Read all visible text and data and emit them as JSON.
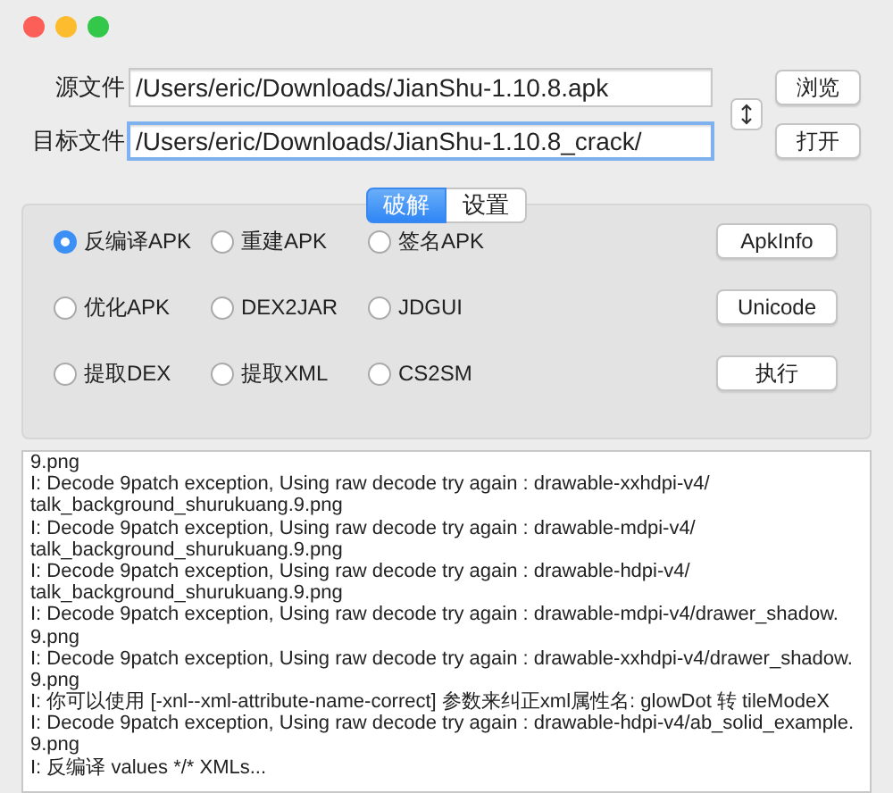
{
  "files": [
    {
      "label": "源文件",
      "value": "/Users/eric/Downloads/JianShu-1.10.8.apk",
      "focused": false,
      "button": "浏览"
    },
    {
      "label": "目标文件",
      "value": "/Users/eric/Downloads/JianShu-1.10.8_crack/",
      "focused": true,
      "button": "打开"
    }
  ],
  "tabs": [
    {
      "label": "破解",
      "selected": true
    },
    {
      "label": "设置",
      "selected": false
    }
  ],
  "option_rows": [
    {
      "options": [
        {
          "label": "反编译APK",
          "selected": true
        },
        {
          "label": "重建APK",
          "selected": false
        },
        {
          "label": "签名APK",
          "selected": false
        }
      ],
      "button": "ApkInfo"
    },
    {
      "options": [
        {
          "label": "优化APK",
          "selected": false
        },
        {
          "label": "DEX2JAR",
          "selected": false
        },
        {
          "label": "JDGUI",
          "selected": false
        }
      ],
      "button": "Unicode"
    },
    {
      "options": [
        {
          "label": "提取DEX",
          "selected": false
        },
        {
          "label": "提取XML",
          "selected": false
        },
        {
          "label": "CS2SM",
          "selected": false
        }
      ],
      "button": "执行"
    }
  ],
  "log_lines": [
    "9.png",
    "I: Decode 9patch exception, Using raw decode try again : drawable-xxhdpi-v4/",
    "talk_background_shurukuang.9.png",
    "I: Decode 9patch exception, Using raw decode try again : drawable-mdpi-v4/",
    "talk_background_shurukuang.9.png",
    "I: Decode 9patch exception, Using raw decode try again : drawable-hdpi-v4/",
    "talk_background_shurukuang.9.png",
    "I: Decode 9patch exception, Using raw decode try again : drawable-mdpi-v4/drawer_shadow.",
    "9.png",
    "I: Decode 9patch exception, Using raw decode try again : drawable-xxhdpi-v4/drawer_shadow.",
    "9.png",
    "I: 你可以使用 [-xnl--xml-attribute-name-correct] 参数来纠正xml属性名: glowDot 转 tileModeX",
    "I: Decode 9patch exception, Using raw decode try again : drawable-hdpi-v4/ab_solid_example.",
    "9.png",
    "I: 反编译 values */* XMLs..."
  ]
}
